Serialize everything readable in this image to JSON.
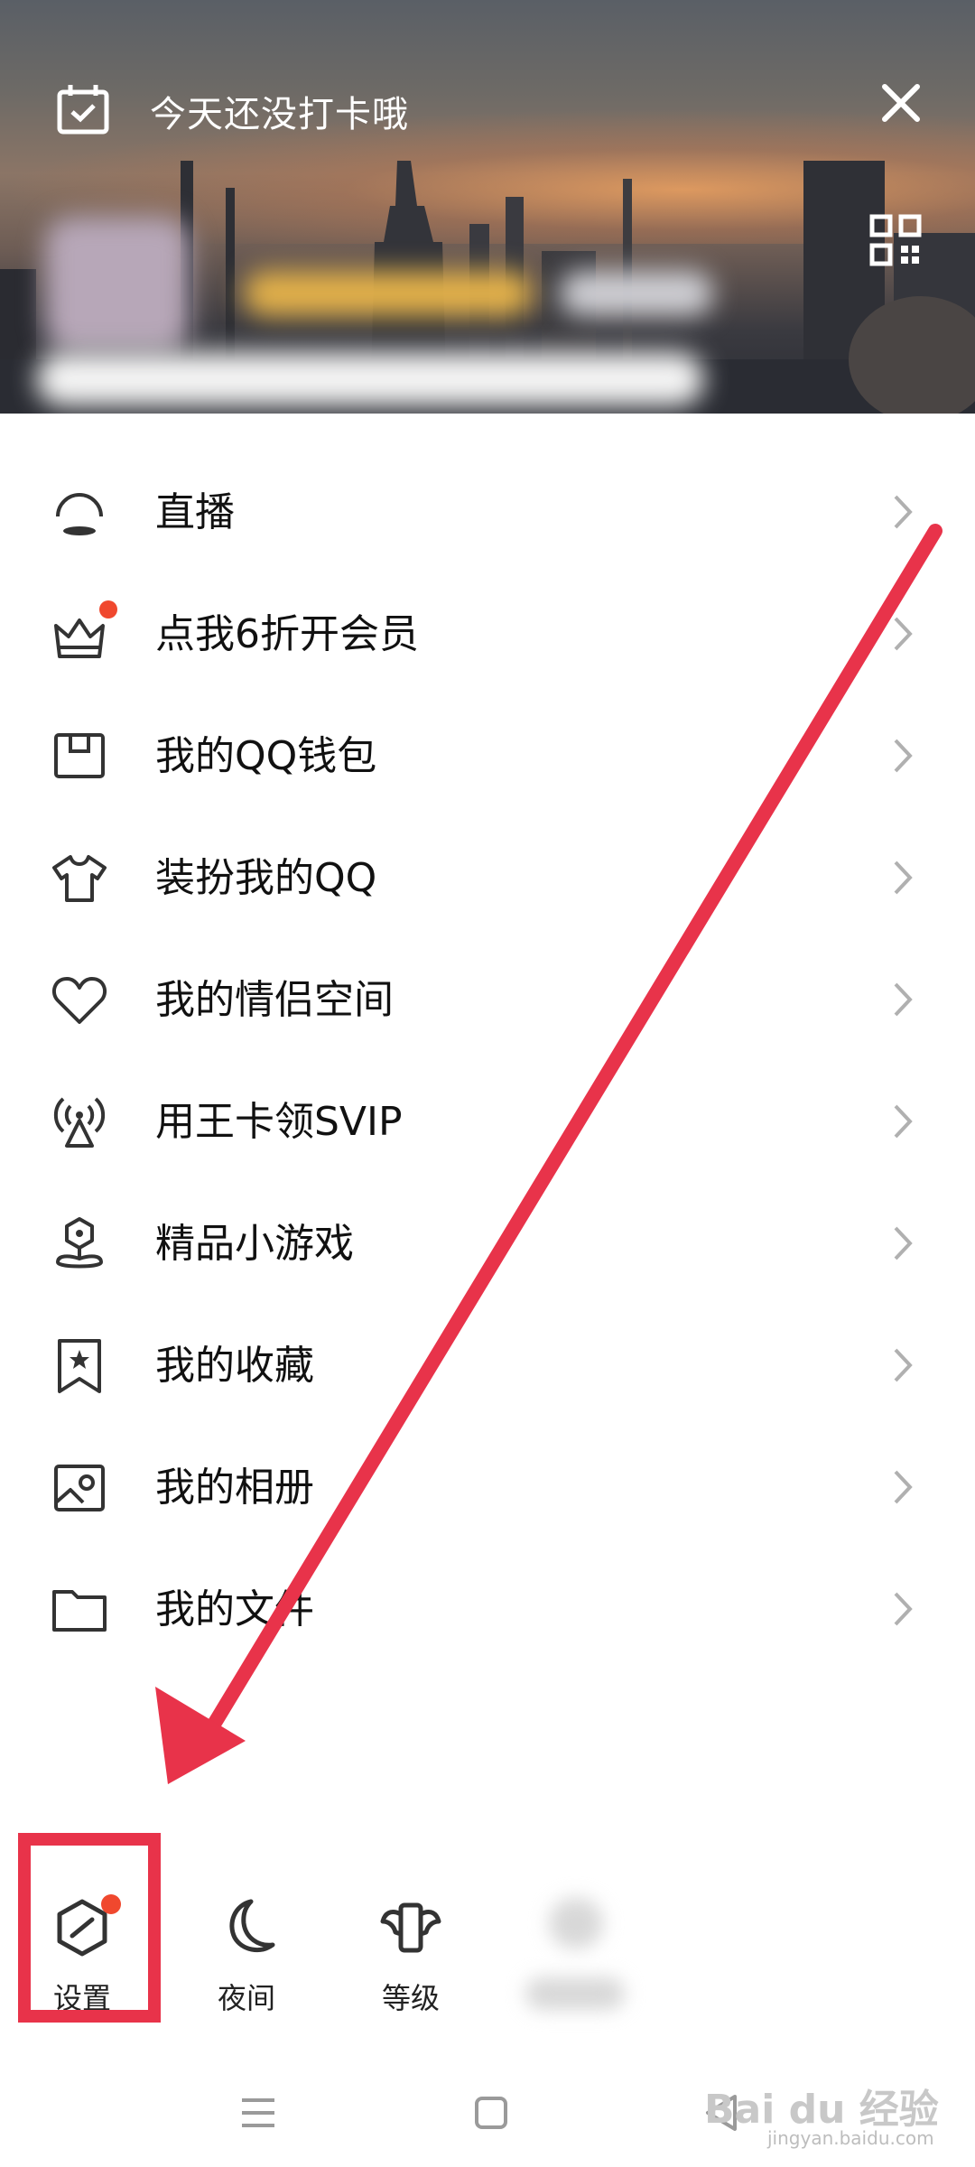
{
  "header": {
    "checkin_text": "今天还没打卡哦",
    "close_icon": "close-icon",
    "qr_icon": "qr-code-icon"
  },
  "menu": {
    "items": [
      {
        "label": "直播",
        "icon": "live-icon",
        "badge": false
      },
      {
        "label": "点我6折开会员",
        "icon": "crown-icon",
        "badge": true
      },
      {
        "label": "我的QQ钱包",
        "icon": "wallet-icon",
        "badge": false
      },
      {
        "label": "装扮我的QQ",
        "icon": "tshirt-icon",
        "badge": false
      },
      {
        "label": "我的情侣空间",
        "icon": "heart-icon",
        "badge": false
      },
      {
        "label": "用王卡领SVIP",
        "icon": "antenna-icon",
        "badge": false
      },
      {
        "label": "精品小游戏",
        "icon": "game-icon",
        "badge": false
      },
      {
        "label": "我的收藏",
        "icon": "bookmark-icon",
        "badge": false
      },
      {
        "label": "我的相册",
        "icon": "photo-icon",
        "badge": false
      },
      {
        "label": "我的文件",
        "icon": "folder-icon",
        "badge": false
      }
    ]
  },
  "toolbar": {
    "settings_label": "设置",
    "night_label": "夜间",
    "level_label": "等级"
  },
  "watermark": {
    "brand": "Bai du 经验",
    "url": "jingyan.baidu.com"
  },
  "colors": {
    "annotation_red": "#e8334a",
    "badge_red": "#f0482e",
    "icon_stroke": "#333333",
    "chevron": "#b0b0b0"
  }
}
